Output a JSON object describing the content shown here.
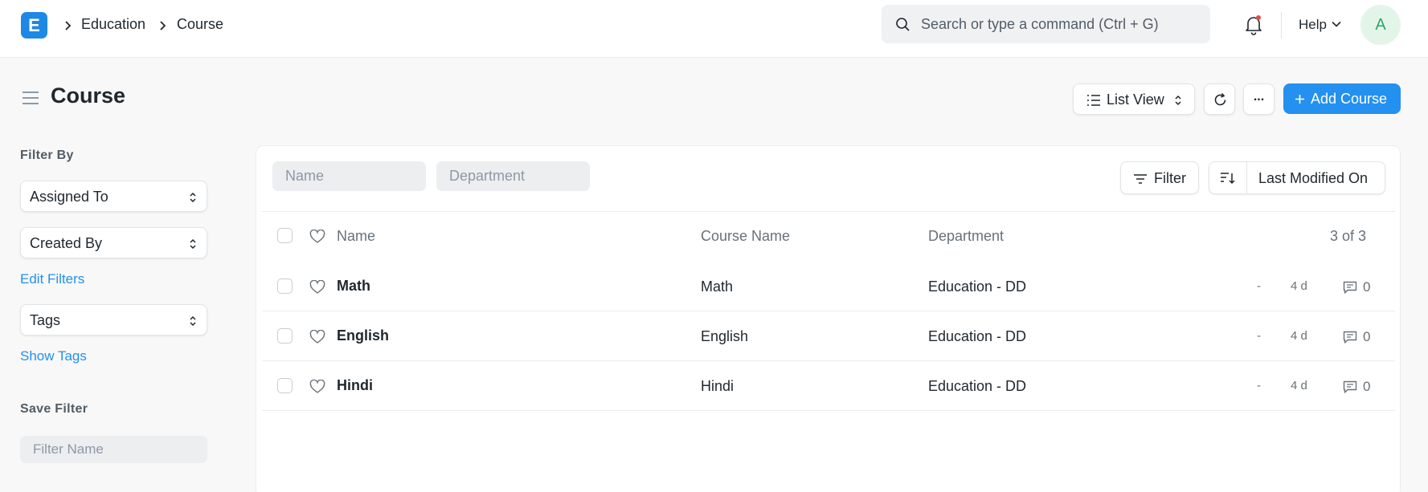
{
  "app": {
    "logo_letter": "E",
    "breadcrumbs": [
      "Education",
      "Course"
    ],
    "search_placeholder": "Search or type a command (Ctrl + G)",
    "help_label": "Help",
    "avatar_letter": "A"
  },
  "page": {
    "title": "Course",
    "list_view_label": "List View",
    "more_label": "...",
    "add_button_label": "Add Course"
  },
  "sidebar": {
    "filter_by_label": "Filter By",
    "assigned_to_label": "Assigned To",
    "created_by_label": "Created By",
    "edit_filters_label": "Edit Filters",
    "tags_label": "Tags",
    "show_tags_label": "Show Tags",
    "save_filter_label": "Save Filter",
    "filter_name_placeholder": "Filter Name"
  },
  "list": {
    "name_filter_placeholder": "Name",
    "department_filter_placeholder": "Department",
    "filter_button_label": "Filter",
    "sort_label": "Last Modified On",
    "columns": {
      "name": "Name",
      "course_name": "Course Name",
      "department": "Department",
      "count": "3 of 3"
    },
    "rows": [
      {
        "name": "Math",
        "course_name": "Math",
        "department": "Education - DD",
        "dash": "-",
        "modified": "4 d",
        "comments": "0"
      },
      {
        "name": "English",
        "course_name": "English",
        "department": "Education - DD",
        "dash": "-",
        "modified": "4 d",
        "comments": "0"
      },
      {
        "name": "Hindi",
        "course_name": "Hindi",
        "department": "Education - DD",
        "dash": "-",
        "modified": "4 d",
        "comments": "0"
      }
    ]
  },
  "colors": {
    "primary": "#2490ef",
    "logo": "#1e88e5",
    "notification_dot": "#e24c4c",
    "avatar_bg": "#e3f5e9",
    "avatar_text": "#30a66d"
  }
}
